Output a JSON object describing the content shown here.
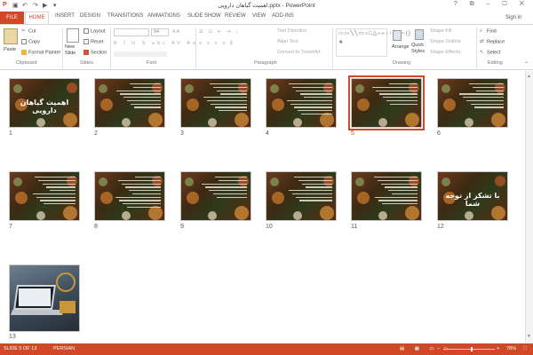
{
  "window": {
    "title": "اهمیت گیاهان دارویی.pptx - PowerPoint",
    "controls": "? ⧉ – ▢ ✕"
  },
  "tabs": [
    {
      "label": "FILE"
    },
    {
      "label": "HOME"
    },
    {
      "label": "INSERT"
    },
    {
      "label": "DESIGN"
    },
    {
      "label": "TRANSITIONS"
    },
    {
      "label": "ANIMATIONS"
    },
    {
      "label": "SLIDE SHOW"
    },
    {
      "label": "REVIEW"
    },
    {
      "label": "VIEW"
    },
    {
      "label": "ADD-INS"
    }
  ],
  "signin": "Sign in",
  "ribbon": {
    "clipboard": {
      "group": "Clipboard",
      "paste": "Paste",
      "cut": "Cut",
      "copy": "Copy",
      "format_painter": "Format Painter"
    },
    "slides": {
      "group": "Slides",
      "new_slide": "New Slide",
      "layout": "Layout",
      "reset": "Reset",
      "section": "Section"
    },
    "font": {
      "group": "Font",
      "size": "54"
    },
    "paragraph": {
      "group": "Paragraph",
      "text_direction": "Text Direction",
      "align_text": "Align Text",
      "convert_smartart": "Convert to SmartArt"
    },
    "drawing": {
      "group": "Drawing",
      "arrange": "Arrange",
      "quick_styles": "Quick Styles",
      "shape_fill": "Shape Fill",
      "shape_outline": "Shape Outline",
      "shape_effects": "Shape Effects"
    },
    "editing": {
      "group": "Editing",
      "find": "Find",
      "replace": "Replace",
      "select": "Select"
    }
  },
  "slides": [
    {
      "number": "1",
      "title": "اهمیت گیاهان دارویی"
    },
    {
      "number": "2"
    },
    {
      "number": "3"
    },
    {
      "number": "4"
    },
    {
      "number": "5",
      "selected": true
    },
    {
      "number": "6"
    },
    {
      "number": "7"
    },
    {
      "number": "8"
    },
    {
      "number": "9"
    },
    {
      "number": "10"
    },
    {
      "number": "11"
    },
    {
      "number": "12",
      "title": "با تشکر از توجه شما"
    },
    {
      "number": "13"
    }
  ],
  "status": {
    "slide_counter": "SLIDE 5 OF 13",
    "language": "PERSIAN",
    "zoom": "78%"
  },
  "colors": {
    "accent": "#d24726",
    "status_bar": "#d24726"
  }
}
